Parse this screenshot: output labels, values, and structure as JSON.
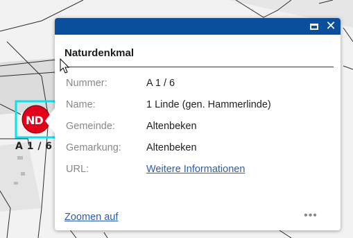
{
  "map": {
    "feature_symbol_text": "ND",
    "feature_label": "A 1 / 6",
    "colors": {
      "symbol_fill": "#e3001b",
      "selection_outline": "#00e5ee"
    }
  },
  "popup": {
    "title": "Naturdenkmal",
    "header_color": "#0a4f9e",
    "attributes": [
      {
        "key": "Nummer:",
        "value": "A 1 / 6"
      },
      {
        "key": "Name:",
        "value": "1 Linde (gen. Hammerlinde)"
      },
      {
        "key": "Gemeinde:",
        "value": "Altenbeken"
      },
      {
        "key": "Gemarkung:",
        "value": "Altenbeken"
      },
      {
        "key": "URL:",
        "value": "Weitere Informationen"
      }
    ],
    "zoom_label": "Zoomen auf",
    "more_label": "•••",
    "maximize_icon": "maximize-icon",
    "close_icon": "close-icon",
    "close_glyph": "✕"
  }
}
